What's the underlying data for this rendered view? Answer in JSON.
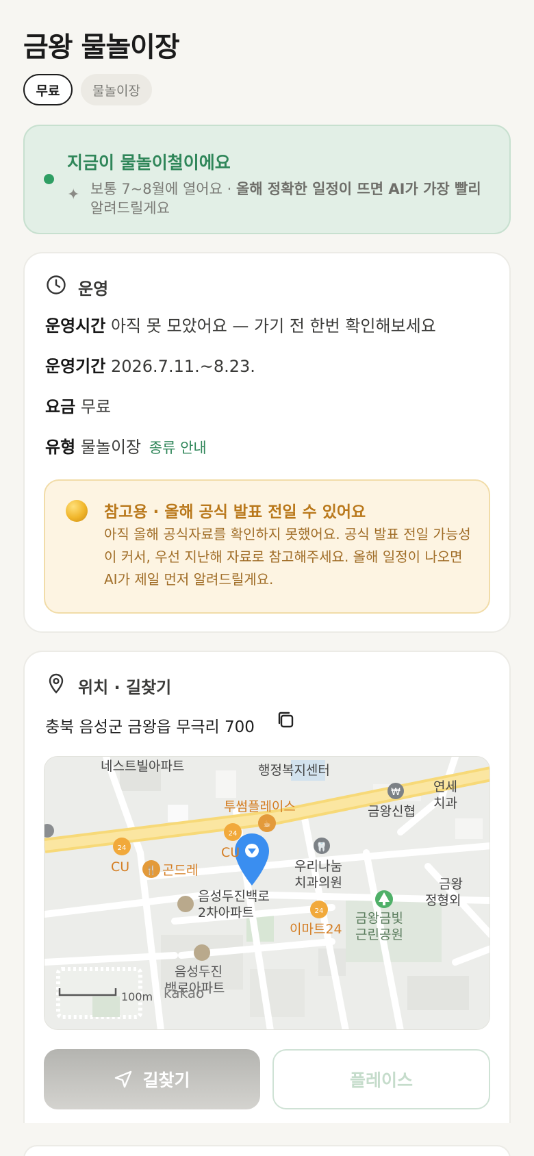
{
  "title": "금왕 물놀이장",
  "chips": {
    "fee": "무료",
    "type": "물놀이장"
  },
  "season": {
    "title": "지금이 물놀이철이에요",
    "desc_prefix": "보통 7~8월에 열어요 · ",
    "desc_bold": "올해 정확한 일정이 뜨면 AI가 가장 빨리",
    "desc_suffix": " 알려드릴게요",
    "accent": "#2f8659"
  },
  "operation": {
    "section_title": "운영",
    "rows": [
      {
        "key": "운영시간",
        "value": "아직 못 모았어요 — 가기 전 한번 확인해보세요"
      },
      {
        "key": "운영기간",
        "value": "2026.7.11.~8.23."
      },
      {
        "key": "요금",
        "value": "무료"
      },
      {
        "key": "유형",
        "value": "물놀이장",
        "link": "종류 안내"
      }
    ],
    "notice": {
      "title": "참고용 · 올해 공식 발표 전일 수 있어요",
      "desc": "아직 올해 공식자료를 확인하지 못했어요. 공식 발표 전일 가능성이 커서, 우선 지난해 자료로 참고해주세요. 올해 일정이 나오면 AI가 제일 먼저 알려드릴게요."
    }
  },
  "location": {
    "section_title": "위치 · 길찾기",
    "address": "충북 음성군 금왕읍 무극리 700",
    "map": {
      "labels": {
        "apt1": "네스트빌아파트",
        "center": "행정복지센터",
        "cafe": "투썸플레이스",
        "bank": "금왕신협",
        "dental_corner_1": "연세",
        "dental_corner_2": "치과",
        "cu1": "CU",
        "cu2": "CU",
        "restaurant": "곤드레",
        "dental_1": "우리나눔",
        "dental_2": "치과의원",
        "apt2_1": "음성두진백로",
        "apt2_2": "2차아파트",
        "emart": "이마트24",
        "park_1": "금왕금빛",
        "park_2": "근린공원",
        "corner_1": "금왕",
        "corner_2": "정형외",
        "apt3_1": "음성두진",
        "apt3_2": "백로아파트",
        "scale": "100m",
        "provider": "kakao"
      }
    },
    "buttons": {
      "navigate": "길찾기",
      "place": "플레이스"
    }
  }
}
